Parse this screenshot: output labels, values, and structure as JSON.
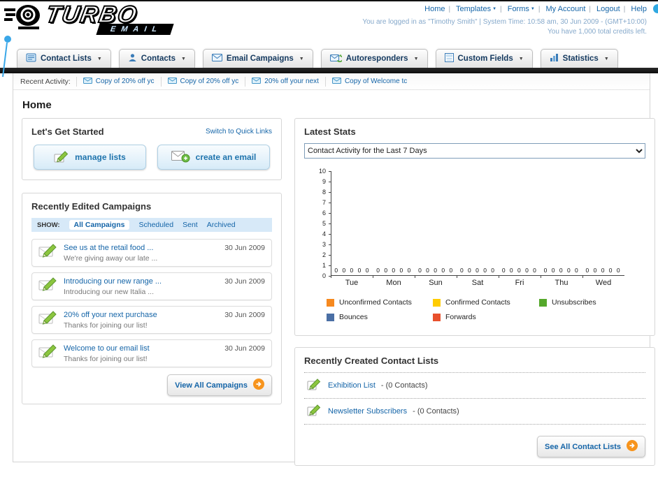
{
  "header": {
    "logo_primary": "TURBO",
    "logo_secondary": "EMAIL",
    "links": [
      {
        "label": "Home"
      },
      {
        "label": "Templates"
      },
      {
        "label": "Forms"
      },
      {
        "label": "My Account"
      },
      {
        "label": "Logout"
      },
      {
        "label": "Help"
      }
    ],
    "login_status": "You are logged in as \"Timothy Smith\" | System Time: 10:58 am, 30 Jun 2009 - (GMT+10:00)",
    "credits": "You have 1,000 total credits left."
  },
  "nav": {
    "items": [
      {
        "label": "Contact Lists"
      },
      {
        "label": "Contacts"
      },
      {
        "label": "Email Campaigns"
      },
      {
        "label": "Autoresponders"
      },
      {
        "label": "Custom Fields"
      },
      {
        "label": "Statistics"
      }
    ]
  },
  "recent_activity": {
    "label": "Recent Activity:",
    "items": [
      "Copy of 20% off yc",
      "Copy of 20% off yc",
      "20% off your next",
      "Copy of Welcome tc"
    ]
  },
  "page_title": "Home",
  "get_started": {
    "title": "Let's Get Started",
    "switch_link": "Switch to Quick Links",
    "manage_lists_label": "manage lists",
    "create_email_label": "create an email"
  },
  "campaigns": {
    "title": "Recently Edited Campaigns",
    "show_label": "SHOW:",
    "filters": [
      "All Campaigns",
      "Scheduled",
      "Sent",
      "Archived"
    ],
    "active_filter": "All Campaigns",
    "items": [
      {
        "title": "See us at the retail food ...",
        "subtitle": "We're giving away our late ...",
        "date": "30 Jun 2009"
      },
      {
        "title": "Introducing our new range ...",
        "subtitle": "Introducing our new Italia ...",
        "date": "30 Jun 2009"
      },
      {
        "title": "20% off your next purchase",
        "subtitle": "Thanks for joining our list!",
        "date": "30 Jun 2009"
      },
      {
        "title": "Welcome to our email list",
        "subtitle": "Thanks for joining our list!",
        "date": "30 Jun 2009"
      }
    ],
    "view_all_label": "View All Campaigns"
  },
  "stats": {
    "title": "Latest Stats",
    "dropdown_value": "Contact Activity for the Last 7 Days",
    "chart_data": {
      "type": "bar",
      "title": "Contact Activity for the Last 7 Days",
      "categories": [
        "Tue",
        "Mon",
        "Sun",
        "Sat",
        "Fri",
        "Thu",
        "Wed"
      ],
      "series": [
        {
          "name": "Unconfirmed Contacts",
          "color": "#F6891F",
          "values": [
            0,
            0,
            0,
            0,
            0,
            0,
            0
          ]
        },
        {
          "name": "Confirmed Contacts",
          "color": "#FFCC00",
          "values": [
            0,
            0,
            0,
            0,
            0,
            0,
            0
          ]
        },
        {
          "name": "Unsubscribes",
          "color": "#55A82B",
          "values": [
            0,
            0,
            0,
            0,
            0,
            0,
            0
          ]
        },
        {
          "name": "Bounces",
          "color": "#4A6FA5",
          "values": [
            0,
            0,
            0,
            0,
            0,
            0,
            0
          ]
        },
        {
          "name": "Forwards",
          "color": "#E8502D",
          "values": [
            0,
            0,
            0,
            0,
            0,
            0,
            0
          ]
        }
      ],
      "ylim": [
        0,
        10
      ],
      "grid": false,
      "legend_position": "bottom",
      "show_value_labels": true
    }
  },
  "contact_lists": {
    "title": "Recently Created Contact Lists",
    "items": [
      {
        "name": "Exhibition List",
        "detail": "- (0 Contacts)"
      },
      {
        "name": "Newsletter Subscribers",
        "detail": "- (0 Contacts)"
      }
    ],
    "see_all_label": "See All Contact Lists"
  }
}
